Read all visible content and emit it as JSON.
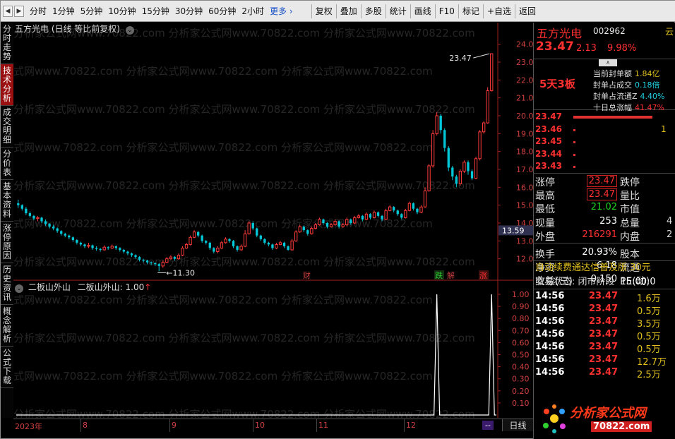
{
  "toolbar": {
    "periods": [
      "分时",
      "1分钟",
      "5分钟",
      "10分钟",
      "15分钟",
      "30分钟",
      "60分钟",
      "2小时",
      "更多 ›"
    ],
    "buttons": [
      "复权",
      "叠加",
      "多股",
      "统计",
      "画线",
      "F10",
      "标记",
      "+自选",
      "返回"
    ]
  },
  "left_tabs": [
    {
      "label": "分时走势",
      "active": false
    },
    {
      "label": "技术分析",
      "active": true
    },
    {
      "label": "成交明细",
      "active": false
    },
    {
      "label": "分价表",
      "active": false
    },
    {
      "label": "基本资料",
      "active": false
    },
    {
      "label": "涨停原因",
      "active": false
    },
    {
      "label": "历史资讯",
      "active": false
    },
    {
      "label": "概念解析",
      "active": false
    },
    {
      "label": "公式下载",
      "active": false
    }
  ],
  "main_chart": {
    "title": "五方光电 (日线 等比前复权)",
    "price_labels": [
      "24.00",
      "23.00",
      "22.00",
      "21.00",
      "20.00",
      "19.00",
      "18.00",
      "17.00",
      "16.00",
      "15.00",
      "14.00",
      "13.00",
      "12.00"
    ],
    "current_price_tag": "13.59",
    "high_annotation": "23.47",
    "low_annotation": "11.30",
    "event_markers": [
      "财",
      "跌",
      "解",
      "涨"
    ],
    "watermark": "分析家公式网www.70822.com"
  },
  "chart_data": {
    "type": "candlestick",
    "title": "五方光电 (日线 等比前复权)",
    "y_range": [
      11.0,
      24.5
    ],
    "colors": {
      "up": "#ff3a3a",
      "down": "#00c8d8"
    },
    "candles": [
      [
        15.1,
        15.0,
        15.3,
        14.85
      ],
      [
        15.0,
        14.8,
        15.05,
        14.7
      ],
      [
        14.8,
        14.55,
        14.9,
        14.45
      ],
      [
        14.55,
        14.4,
        14.65,
        14.3
      ],
      [
        14.4,
        14.25,
        14.45,
        14.15
      ],
      [
        14.25,
        14.3,
        14.4,
        14.1
      ],
      [
        14.3,
        14.1,
        14.35,
        14.0
      ],
      [
        14.1,
        13.95,
        14.2,
        13.85
      ],
      [
        13.95,
        13.8,
        14.0,
        13.7
      ],
      [
        13.8,
        13.7,
        13.9,
        13.6
      ],
      [
        13.7,
        13.55,
        13.75,
        13.45
      ],
      [
        13.55,
        13.4,
        13.6,
        13.3
      ],
      [
        13.4,
        13.3,
        13.45,
        13.2
      ],
      [
        13.3,
        13.2,
        13.35,
        13.1
      ],
      [
        13.2,
        13.05,
        13.25,
        12.95
      ],
      [
        13.05,
        12.9,
        13.1,
        12.8
      ],
      [
        12.9,
        12.8,
        12.95,
        12.7
      ],
      [
        12.8,
        12.7,
        12.85,
        12.6
      ],
      [
        12.7,
        12.75,
        12.9,
        12.6
      ],
      [
        12.75,
        12.6,
        12.8,
        12.5
      ],
      [
        12.6,
        12.55,
        12.7,
        12.45
      ],
      [
        12.55,
        12.5,
        12.6,
        12.4
      ],
      [
        12.5,
        12.65,
        12.75,
        12.45
      ],
      [
        12.65,
        12.6,
        12.7,
        12.5
      ],
      [
        12.6,
        12.7,
        12.8,
        12.55
      ],
      [
        12.7,
        12.6,
        12.75,
        12.5
      ],
      [
        12.6,
        12.5,
        12.65,
        12.4
      ],
      [
        12.5,
        12.4,
        12.55,
        12.3
      ],
      [
        12.4,
        12.3,
        12.45,
        12.2
      ],
      [
        12.3,
        12.2,
        12.35,
        12.1
      ],
      [
        12.2,
        12.1,
        12.25,
        12.0
      ],
      [
        12.1,
        11.95,
        12.15,
        11.85
      ],
      [
        11.95,
        11.9,
        12.0,
        11.8
      ],
      [
        11.9,
        11.8,
        11.95,
        11.7
      ],
      [
        11.8,
        11.75,
        11.85,
        11.65
      ],
      [
        11.75,
        11.7,
        11.8,
        11.6
      ],
      [
        11.7,
        11.6,
        11.75,
        11.3
      ],
      [
        11.6,
        11.8,
        11.9,
        11.5
      ],
      [
        11.8,
        12.0,
        12.1,
        11.75
      ],
      [
        12.0,
        12.1,
        12.2,
        11.95
      ],
      [
        12.1,
        12.0,
        12.15,
        11.9
      ],
      [
        12.0,
        12.2,
        12.3,
        11.95
      ],
      [
        12.2,
        12.6,
        12.7,
        12.15
      ],
      [
        12.6,
        12.8,
        12.9,
        12.55
      ],
      [
        12.8,
        13.2,
        13.3,
        12.75
      ],
      [
        13.2,
        13.5,
        13.6,
        13.15
      ],
      [
        13.5,
        13.3,
        13.55,
        13.2
      ],
      [
        13.3,
        13.0,
        13.35,
        12.9
      ],
      [
        13.0,
        12.9,
        13.05,
        12.8
      ],
      [
        12.9,
        12.6,
        12.95,
        12.5
      ],
      [
        12.6,
        12.4,
        12.65,
        12.3
      ],
      [
        12.4,
        12.6,
        12.7,
        12.3
      ],
      [
        12.6,
        12.9,
        13.0,
        12.55
      ],
      [
        12.9,
        13.1,
        13.2,
        12.85
      ],
      [
        13.1,
        13.0,
        13.15,
        12.9
      ],
      [
        13.0,
        12.7,
        13.05,
        12.6
      ],
      [
        12.7,
        12.5,
        12.75,
        12.4
      ],
      [
        12.5,
        12.7,
        12.8,
        12.45
      ],
      [
        12.7,
        13.4,
        13.6,
        12.65
      ],
      [
        13.4,
        14.0,
        14.1,
        13.35
      ],
      [
        14.0,
        13.7,
        14.1,
        13.6
      ],
      [
        13.7,
        13.3,
        13.75,
        13.2
      ],
      [
        13.3,
        13.1,
        13.35,
        13.0
      ],
      [
        13.1,
        12.9,
        13.15,
        12.8
      ],
      [
        12.9,
        12.8,
        12.95,
        12.7
      ],
      [
        12.8,
        12.6,
        12.85,
        12.5
      ],
      [
        12.6,
        12.8,
        12.9,
        12.55
      ],
      [
        12.8,
        12.9,
        13.0,
        12.75
      ],
      [
        12.9,
        12.7,
        12.95,
        12.6
      ],
      [
        12.7,
        12.5,
        12.75,
        12.45
      ],
      [
        12.5,
        13.0,
        13.1,
        12.45
      ],
      [
        13.0,
        13.5,
        13.6,
        12.95
      ],
      [
        13.5,
        13.8,
        13.9,
        13.45
      ],
      [
        13.8,
        13.6,
        13.85,
        13.5
      ],
      [
        13.6,
        13.4,
        13.65,
        13.3
      ],
      [
        13.4,
        13.7,
        13.8,
        13.35
      ],
      [
        13.7,
        13.9,
        14.0,
        13.65
      ],
      [
        13.9,
        14.2,
        14.3,
        13.85
      ],
      [
        14.2,
        14.0,
        14.25,
        13.9
      ],
      [
        14.0,
        13.8,
        14.05,
        13.7
      ],
      [
        13.8,
        13.9,
        14.0,
        13.75
      ],
      [
        13.9,
        14.1,
        14.2,
        13.85
      ],
      [
        14.1,
        13.8,
        14.15,
        13.7
      ],
      [
        13.8,
        13.9,
        14.0,
        13.75
      ],
      [
        13.9,
        14.2,
        14.3,
        13.85
      ],
      [
        14.2,
        14.0,
        14.25,
        13.9
      ],
      [
        14.0,
        14.3,
        14.4,
        13.95
      ],
      [
        14.3,
        14.4,
        14.5,
        14.25
      ],
      [
        14.4,
        14.2,
        14.45,
        14.1
      ],
      [
        14.2,
        14.5,
        14.6,
        14.15
      ],
      [
        14.5,
        14.3,
        14.55,
        14.2
      ],
      [
        14.3,
        14.6,
        14.7,
        14.25
      ],
      [
        14.6,
        14.4,
        14.65,
        14.3
      ],
      [
        14.4,
        14.2,
        14.45,
        14.1
      ],
      [
        14.2,
        14.7,
        14.8,
        14.15
      ],
      [
        14.7,
        14.9,
        15.0,
        14.65
      ],
      [
        14.9,
        14.7,
        14.95,
        14.6
      ],
      [
        14.7,
        14.5,
        14.75,
        14.4
      ],
      [
        14.5,
        14.3,
        14.55,
        14.2
      ],
      [
        14.3,
        14.7,
        14.8,
        14.25
      ],
      [
        14.7,
        15.1,
        15.2,
        14.65
      ],
      [
        15.1,
        14.8,
        15.15,
        14.7
      ],
      [
        14.8,
        14.6,
        14.85,
        14.5
      ],
      [
        14.6,
        14.9,
        15.0,
        14.55
      ],
      [
        14.9,
        15.8,
        16.0,
        14.85
      ],
      [
        15.8,
        17.2,
        17.3,
        15.75
      ],
      [
        17.2,
        19.0,
        19.2,
        17.1
      ],
      [
        19.0,
        20.0,
        20.2,
        18.9
      ],
      [
        20.0,
        19.2,
        20.1,
        19.0
      ],
      [
        19.2,
        18.2,
        19.3,
        18.0
      ],
      [
        18.2,
        17.1,
        18.3,
        16.9
      ],
      [
        17.1,
        16.6,
        17.2,
        16.4
      ],
      [
        16.6,
        16.2,
        16.7,
        16.0
      ],
      [
        16.2,
        16.9,
        17.0,
        16.1
      ],
      [
        16.9,
        17.4,
        17.5,
        16.8
      ],
      [
        17.4,
        16.9,
        17.5,
        16.7
      ],
      [
        16.9,
        16.5,
        17.0,
        16.4
      ],
      [
        16.5,
        17.6,
        17.7,
        16.45
      ],
      [
        17.6,
        19.1,
        19.2,
        17.5
      ],
      [
        19.1,
        19.6,
        19.7,
        19.0
      ],
      [
        19.6,
        21.4,
        21.6,
        19.55
      ],
      [
        21.4,
        23.47,
        23.47,
        21.35
      ]
    ],
    "price_ticks": [
      24,
      23,
      22,
      21,
      20,
      19,
      18,
      17,
      16,
      15,
      14,
      13,
      12
    ]
  },
  "sub_chart": {
    "title": "二板山外山",
    "indicator_label": "二板山外山: 1.00",
    "indicator_arrow": "↑",
    "y_labels": [
      "1.00",
      "0.90",
      "0.80",
      "0.70",
      "0.60",
      "0.50",
      "0.40",
      "0.30",
      "0.20",
      "0.10"
    ],
    "values": [
      1.0,
      1.0
    ]
  },
  "bottom_dates": [
    "2023年",
    "8",
    "9",
    "10",
    "11",
    "12",
    "--"
  ],
  "period_label": "日线",
  "right_panel": {
    "stock_name": "五方光电",
    "stock_code": "002962",
    "cut_char": "云",
    "price": "23.47",
    "change": "2.13",
    "change_pct": "9.98%",
    "boards": "5天3板",
    "limit_rows": [
      {
        "label": "当前封单额",
        "value": "1.84亿",
        "color": "yellow"
      },
      {
        "label": "封单占成交",
        "value": "0.18倍",
        "color": "cyan"
      },
      {
        "label": "封单占流通Z",
        "value": "4.40%",
        "color": "cyan"
      },
      {
        "label": "十日总涨幅",
        "value": "41.47%",
        "color": "red"
      }
    ],
    "queue": [
      {
        "price": "23.47",
        "vol": ""
      },
      {
        "price": "23.46",
        "vol": "1"
      },
      {
        "price": "23.45",
        "vol": ""
      },
      {
        "price": "23.44",
        "vol": ""
      },
      {
        "price": "23.43",
        "vol": ""
      }
    ],
    "quote_rows": [
      {
        "l1": "涨停",
        "v1": "23.47",
        "c1": "#ff3030",
        "boxed": true,
        "l2": "跌停",
        "v2": ""
      },
      {
        "l1": "最高",
        "v1": "23.47",
        "c1": "#ff3030",
        "boxed": true,
        "l2": "量比",
        "v2": ""
      },
      {
        "l1": "最低",
        "v1": "21.02",
        "c1": "#20d020",
        "boxed": false,
        "l2": "市值",
        "v2": ""
      },
      {
        "l1": "现量",
        "v1": "253",
        "c1": "#ffffff",
        "boxed": false,
        "l2": "总量",
        "v2": "4"
      },
      {
        "l1": "外盘",
        "v1": "216291",
        "c1": "#ff3030",
        "boxed": false,
        "l2": "内盘",
        "v2": "2"
      },
      {
        "l1": "换手",
        "v1": "20.93%",
        "c1": "#ffffff",
        "boxed": false,
        "l2": "股本",
        "v2": ""
      },
      {
        "l1": "净资",
        "v1": "6.18",
        "c1": "#ffffff",
        "boxed": false,
        "l2": "流通",
        "v2": ""
      },
      {
        "l1": "收益(三)",
        "v1": "0.150",
        "c1": "#ffffff",
        "boxed": false,
        "l2": "PE(动)",
        "v2": ""
      }
    ],
    "ad_line": "自动续费通达信普及版  30元",
    "trade_status": "交易状态: 闭市阶段",
    "trade_time": "15:00:0",
    "ticks": [
      {
        "time": "14:56",
        "price": "23.47",
        "vol": "1.6万"
      },
      {
        "time": "14:56",
        "price": "23.47",
        "vol": "0.5万"
      },
      {
        "time": "14:56",
        "price": "23.47",
        "vol": "3.5万"
      },
      {
        "time": "14:56",
        "price": "23.47",
        "vol": "0.5万"
      },
      {
        "time": "14:56",
        "price": "23.47",
        "vol": "0.5万"
      },
      {
        "time": "14:56",
        "price": "23.47",
        "vol": "12.7万"
      },
      {
        "time": "14:56",
        "price": "23.47",
        "vol": "2.5万"
      }
    ]
  },
  "logo": {
    "text": "分析家公式网",
    "url": "70822.com"
  }
}
